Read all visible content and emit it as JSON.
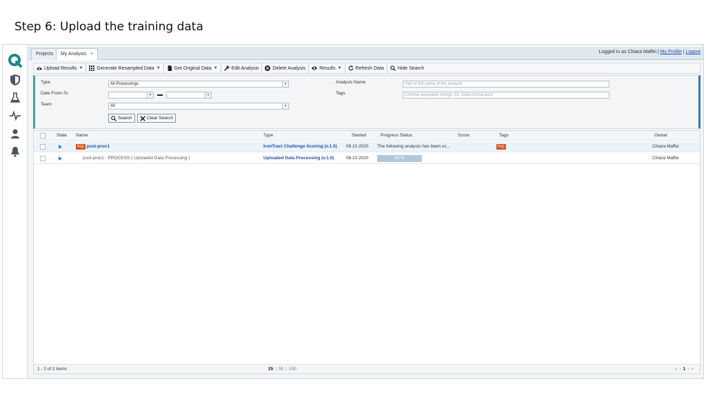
{
  "slide": {
    "title": "Step 6: Upload the training data"
  },
  "tabs": [
    {
      "label": "Projects"
    },
    {
      "label": "My Analysis",
      "close": "×"
    }
  ],
  "user": {
    "logged_in_prefix": "Logged in as",
    "name": "Chiara Maffei",
    "sep": "|",
    "my_profile": "My Profile",
    "logout": "Logout"
  },
  "toolbar": {
    "upload_results": "Upload Results",
    "generate_resampled": "Generate Resampled Data",
    "get_original": "Get Original Data",
    "edit_analysis": "Edit Analysis",
    "delete_analysis": "Delete Analysis",
    "results": "Results",
    "refresh_data": "Refresh Data",
    "hide_search": "Hide Search"
  },
  "search": {
    "type_label": "Type",
    "type_value": "All Processings",
    "date_label": "Date From-To",
    "team_label": "Team",
    "team_value": "All",
    "analysis_name_label": "Analysis Name",
    "analysis_name_placeholder": "Part or full name of the analysis",
    "tags_label": "Tags",
    "tags_placeholder": "Comma separated strings. Ex: brain,miccai,best",
    "search_button": "Search",
    "clear_button": "Clear Search"
  },
  "grid": {
    "columns": {
      "state": "State",
      "name": "Name",
      "type": "Type",
      "started": "Started",
      "progress": "Progress Status",
      "score": "Score",
      "tags": "Tags",
      "owner": "Owner"
    },
    "rows": [
      {
        "badge": "hcp",
        "name": "post-proc1",
        "type": "IronTract Challenge Scoring (v.1.0)",
        "started": "08.10.2020",
        "progress": "The following analysis has been sc...",
        "score": "",
        "tag": "hcp",
        "owner": "Chiara Maffei"
      },
      {
        "name": "post-proc1 - PROCESS ( Uploaded Data Processing )",
        "type": "Uploaded Data Processing (v.1.0)",
        "started": "08.10.2020",
        "progress_label": "60 %",
        "progress_value": 0.6,
        "owner": "Chiara Maffei"
      }
    ],
    "footer": {
      "count": "1 - 2 of 2 items",
      "size_25": "25",
      "size_50": "50",
      "size_100": "100",
      "sep": "|",
      "page_first": "«",
      "page_prev": "‹",
      "page_current": "1",
      "page_next": "›",
      "page_last": "»"
    }
  },
  "colors": {
    "accent_teal": "#43a29a",
    "link_blue": "#1f4fa8",
    "badge_orange": "#d44d1c",
    "rail_icon": "#4a5560"
  }
}
